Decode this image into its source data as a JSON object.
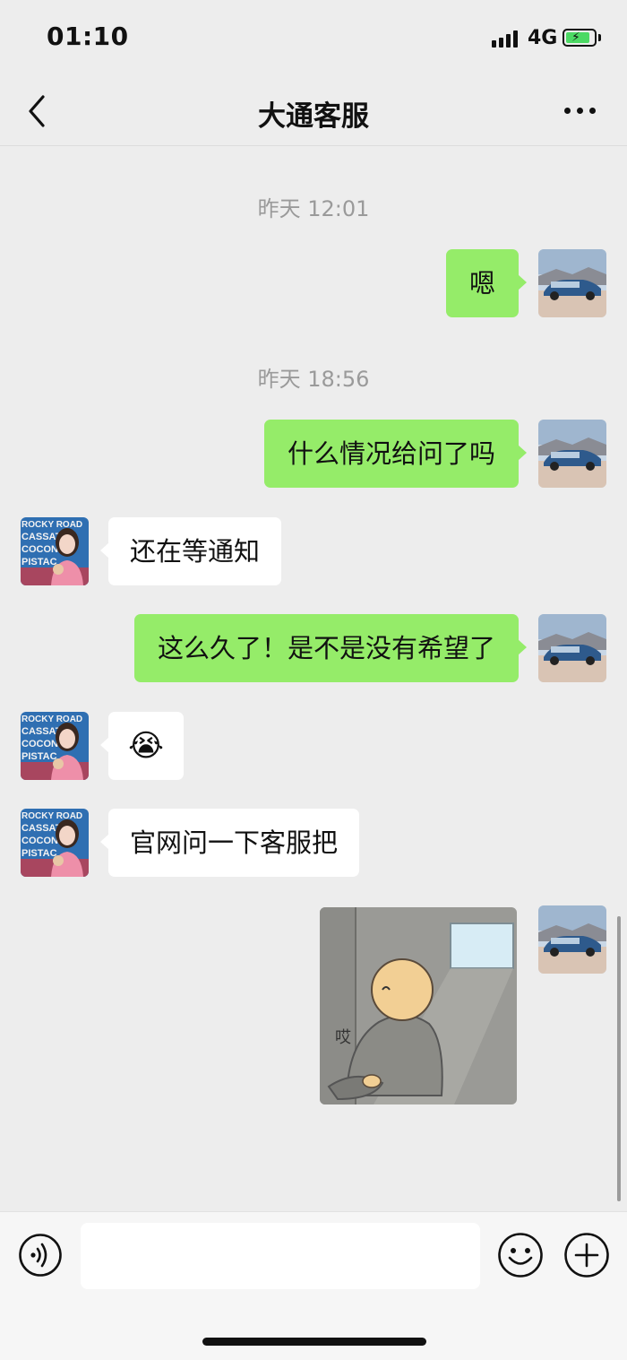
{
  "status_bar": {
    "time": "01:10",
    "network": "4G",
    "battery_charging": true,
    "battery_level_fraction": 0.85,
    "battery_color": "#4cd964"
  },
  "nav": {
    "back_icon": "chevron-left-icon",
    "title": "大通客服",
    "more_icon": "more-horizontal-icon"
  },
  "conversation": {
    "timestamps": [
      "昨天 12:01",
      "昨天 18:56"
    ],
    "messages": [
      {
        "direction": "out",
        "type": "text",
        "text": "嗯"
      },
      {
        "direction": "out",
        "type": "text",
        "text": "什么情况给问了吗"
      },
      {
        "direction": "in",
        "type": "text",
        "text": "还在等通知"
      },
      {
        "direction": "out",
        "type": "text",
        "text": "这么久了！是不是没有希望了"
      },
      {
        "direction": "in",
        "type": "emoji",
        "text": "😭",
        "icon": "crying-face-emoji"
      },
      {
        "direction": "in",
        "type": "text",
        "text": "官网问一下客服把"
      },
      {
        "direction": "out",
        "type": "sticker",
        "caption": "哎",
        "icon": "sighing-person-sticker"
      }
    ],
    "my_avatar_icon": "blue-car-avatar",
    "their_avatar_icon": "person-photo-avatar",
    "their_avatar_text": [
      "ROCKY ROAD",
      "CASSATA",
      "COCONUT",
      "PISTACHIO"
    ]
  },
  "input_bar": {
    "voice_icon": "voice-icon",
    "emoji_icon": "emoji-icon",
    "plus_icon": "plus-icon",
    "message_value": ""
  },
  "colors": {
    "background": "#ededed",
    "outgoing_bubble": "#95ec69",
    "incoming_bubble": "#ffffff"
  }
}
